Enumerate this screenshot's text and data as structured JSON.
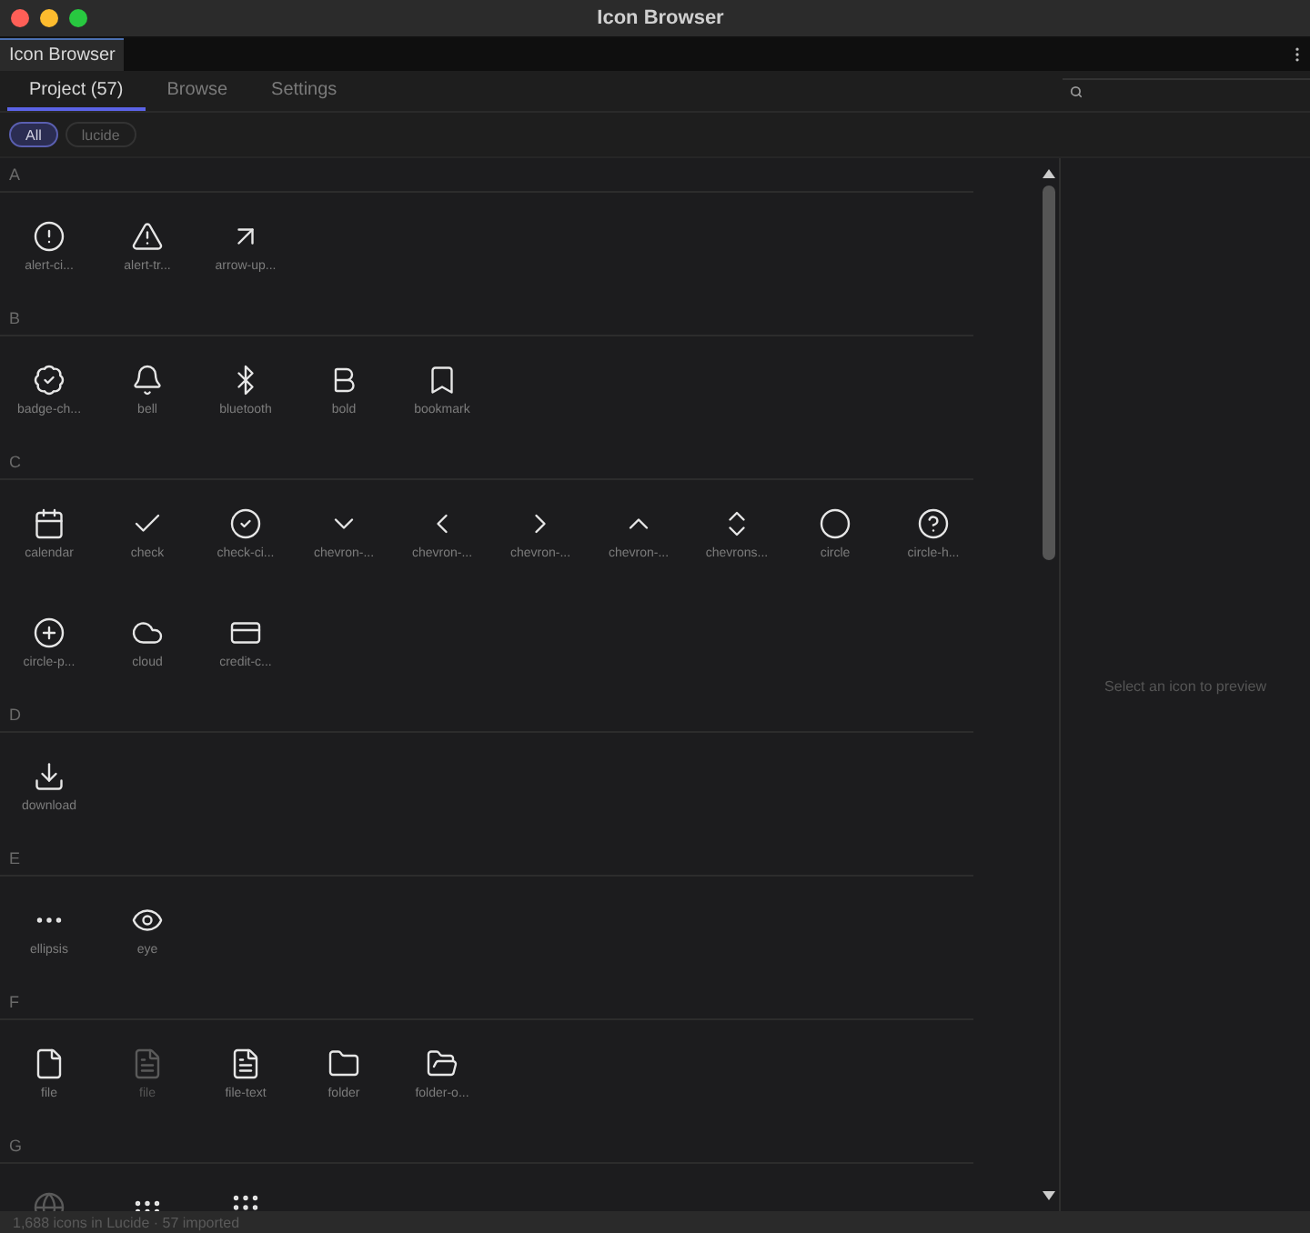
{
  "window": {
    "title": "Icon Browser"
  },
  "doc_tab": {
    "label": "Icon Browser"
  },
  "tabs": [
    {
      "label": "Project (57)",
      "selected": true
    },
    {
      "label": "Browse",
      "selected": false
    },
    {
      "label": "Settings",
      "selected": false
    }
  ],
  "filters": [
    {
      "label": "All",
      "selected": true
    },
    {
      "label": "lucide",
      "selected": false
    }
  ],
  "sections": [
    {
      "letter": "A",
      "items": [
        {
          "label": "alert-ci...",
          "dimmed": false
        },
        {
          "label": "alert-tr...",
          "dimmed": false
        },
        {
          "label": "arrow-up...",
          "dimmed": false
        }
      ]
    },
    {
      "letter": "B",
      "items": [
        {
          "label": "badge-ch...",
          "dimmed": false
        },
        {
          "label": "bell",
          "dimmed": false
        },
        {
          "label": "bluetooth",
          "dimmed": false
        },
        {
          "label": "bold",
          "dimmed": false
        },
        {
          "label": "bookmark",
          "dimmed": false
        }
      ]
    },
    {
      "letter": "C",
      "items": [
        {
          "label": "calendar",
          "dimmed": false
        },
        {
          "label": "check",
          "dimmed": false
        },
        {
          "label": "check-ci...",
          "dimmed": false
        },
        {
          "label": "chevron-...",
          "dimmed": false
        },
        {
          "label": "chevron-...",
          "dimmed": false
        },
        {
          "label": "chevron-...",
          "dimmed": false
        },
        {
          "label": "chevron-...",
          "dimmed": false
        },
        {
          "label": "chevrons...",
          "dimmed": false
        },
        {
          "label": "circle",
          "dimmed": false
        },
        {
          "label": "circle-h...",
          "dimmed": false
        },
        {
          "label": "circle-p...",
          "dimmed": false
        },
        {
          "label": "cloud",
          "dimmed": false
        },
        {
          "label": "credit-c...",
          "dimmed": false
        }
      ]
    },
    {
      "letter": "D",
      "items": [
        {
          "label": "download",
          "dimmed": false
        }
      ]
    },
    {
      "letter": "E",
      "items": [
        {
          "label": "ellipsis",
          "dimmed": false
        },
        {
          "label": "eye",
          "dimmed": false
        }
      ]
    },
    {
      "letter": "F",
      "items": [
        {
          "label": "file",
          "dimmed": false
        },
        {
          "label": "file",
          "dimmed": true
        },
        {
          "label": "file-text",
          "dimmed": false
        },
        {
          "label": "folder",
          "dimmed": false
        },
        {
          "label": "folder-o...",
          "dimmed": false
        }
      ]
    },
    {
      "letter": "G",
      "items": [
        {
          "dimmed": true
        },
        {
          "dimmed": false
        },
        {
          "dimmed": false
        }
      ]
    }
  ],
  "preview": {
    "message": "Select an icon to preview"
  },
  "status_bar": "1,688 icons in Lucide · 57 imported"
}
